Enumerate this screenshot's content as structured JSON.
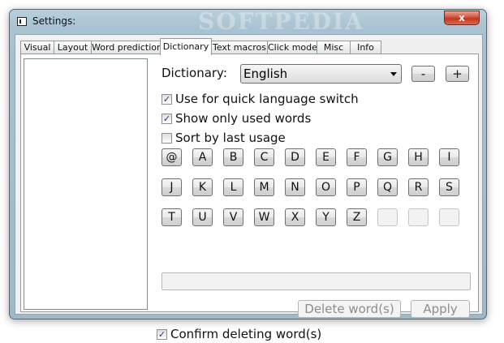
{
  "window": {
    "title": "Settings:",
    "watermark": "SOFTPEDIA",
    "close_label": "x"
  },
  "tabs": [
    {
      "label": "Visual"
    },
    {
      "label": "Layout"
    },
    {
      "label": "Word prediction"
    },
    {
      "label": "Dictionary",
      "active": true
    },
    {
      "label": "Text macros"
    },
    {
      "label": "Click mode"
    },
    {
      "label": "Misc"
    },
    {
      "label": "Info"
    }
  ],
  "dictionary": {
    "label": "Dictionary:",
    "selected": "English",
    "minus_label": "-",
    "plus_label": "+"
  },
  "options": {
    "quick_switch": {
      "label": "Use for quick language switch",
      "checked": true
    },
    "only_used": {
      "label": "Show only used words",
      "checked": true
    },
    "sort_last": {
      "label": "Sort by last usage",
      "checked": false
    }
  },
  "letters": [
    "@",
    "A",
    "B",
    "C",
    "D",
    "E",
    "F",
    "G",
    "H",
    "I",
    "J",
    "K",
    "L",
    "M",
    "N",
    "O",
    "P",
    "Q",
    "R",
    "S",
    "T",
    "U",
    "V",
    "W",
    "X",
    "Y",
    "Z",
    "",
    "",
    ""
  ],
  "actions": {
    "delete_label": "Delete word(s)",
    "apply_label": "Apply"
  },
  "confirm": {
    "label": "Confirm deleting word(s)",
    "checked": true
  },
  "check_glyph": "✓"
}
